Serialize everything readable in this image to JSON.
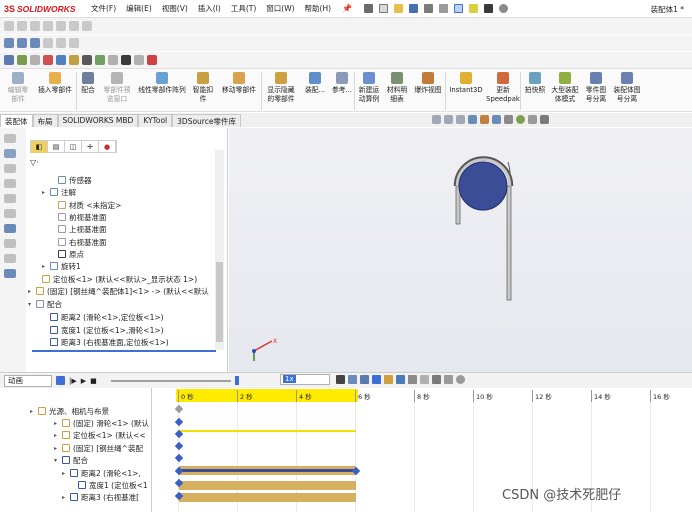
{
  "app": {
    "brand": "SOLIDWORKS",
    "doc_title": "装配体1 *"
  },
  "menu": [
    "文件(F)",
    "编辑(E)",
    "视图(V)",
    "插入(I)",
    "工具(T)",
    "窗口(W)",
    "帮助(H)"
  ],
  "commands": [
    {
      "label": "编辑零\n部件",
      "disabled": true,
      "icon_color": "#9bb0c8"
    },
    {
      "label": "插入零部件",
      "disabled": false,
      "icon_color": "#e8b04a"
    },
    {
      "label": "配合",
      "disabled": false,
      "icon_color": "#6d7fa0"
    },
    {
      "label": "零部件预\n览窗口",
      "disabled": true,
      "icon_color": "#b5b5b5"
    },
    {
      "label": "线性零部件阵列",
      "disabled": false,
      "icon_color": "#6aa0d8"
    },
    {
      "label": "智能扣\n件",
      "disabled": false,
      "icon_color": "#c9a040"
    },
    {
      "label": "移动零部件",
      "disabled": false,
      "icon_color": "#d8a34a"
    },
    {
      "label": "显示隐藏\n的零部件",
      "disabled": false,
      "icon_color": "#cfa040"
    },
    {
      "label": "装配...",
      "disabled": false,
      "icon_color": "#5e8fc8"
    },
    {
      "label": "参考...",
      "disabled": false,
      "icon_color": "#8a9ab8"
    },
    {
      "label": "新建运\n动算例",
      "disabled": false,
      "icon_color": "#6b8fd0"
    },
    {
      "label": "材料明\n细表",
      "disabled": false,
      "icon_color": "#7a9070"
    },
    {
      "label": "爆炸视图",
      "disabled": false,
      "icon_color": "#c07a3a"
    },
    {
      "label": "Instant3D",
      "disabled": false,
      "icon_color": "#e0b030"
    },
    {
      "label": "更新\nSpeedpak",
      "disabled": false,
      "icon_color": "#d06a3a"
    },
    {
      "label": "拍快照",
      "disabled": false,
      "icon_color": "#6aa0c0"
    },
    {
      "label": "大型装配\n体模式",
      "disabled": false,
      "icon_color": "#8fb040"
    },
    {
      "label": "零件图\n号分离",
      "disabled": false,
      "icon_color": "#6a80b0"
    },
    {
      "label": "装配体图\n号分离",
      "disabled": false,
      "icon_color": "#6a80b0"
    }
  ],
  "tabs": [
    "装配体",
    "布局",
    "SOLIDWORKS MBD",
    "KYTool",
    "3DSource零件库"
  ],
  "feature_tree": [
    {
      "text": "传感器",
      "exp": ""
    },
    {
      "text": "注解",
      "exp": "▸"
    },
    {
      "text": "材质 <未指定>",
      "exp": ""
    },
    {
      "text": "前视基准面",
      "exp": ""
    },
    {
      "text": "上视基准面",
      "exp": ""
    },
    {
      "text": "右视基准面",
      "exp": ""
    },
    {
      "text": "原点",
      "exp": ""
    },
    {
      "text": "旋转1",
      "exp": "▸"
    },
    {
      "text": "定位板<1> (默认<<默认>_显示状态 1>)",
      "exp": ""
    },
    {
      "text": "(固定) [钢丝绳^装配体1]<1> -> (默认<<默认",
      "exp": "▸"
    },
    {
      "text": "配合",
      "exp": "▾"
    },
    {
      "text": "距离2 (滑轮<1>,定位板<1>)",
      "exp": ""
    },
    {
      "text": "宽度1 (定位板<1>,滑轮<1>)",
      "exp": ""
    },
    {
      "text": "距离3 (右视基准面,定位板<1>)",
      "exp": ""
    }
  ],
  "motion": {
    "study_type": "动画",
    "speed": "1x",
    "tree": [
      {
        "text": "光源、相机与布景",
        "exp": "▸"
      },
      {
        "text": "(固定) 滑轮<1> (默认",
        "exp": "▸"
      },
      {
        "text": "定位板<1> (默认<<",
        "exp": "▸"
      },
      {
        "text": "(固定) [钢丝绳^装配",
        "exp": "▸"
      },
      {
        "text": "配合",
        "exp": "▾"
      },
      {
        "text": "距离2 (滑轮<1>,",
        "exp": "▸"
      },
      {
        "text": "宽度1 (定位板<1",
        "exp": ""
      },
      {
        "text": "距离3 (右视基准[",
        "exp": "▸"
      }
    ],
    "ruler": [
      "0 秒",
      "2 秒",
      "4 秒",
      "6 秒",
      "8 秒",
      "10 秒",
      "12 秒",
      "14 秒",
      "16 秒"
    ]
  },
  "watermark": "CSDN @技术死肥仔"
}
